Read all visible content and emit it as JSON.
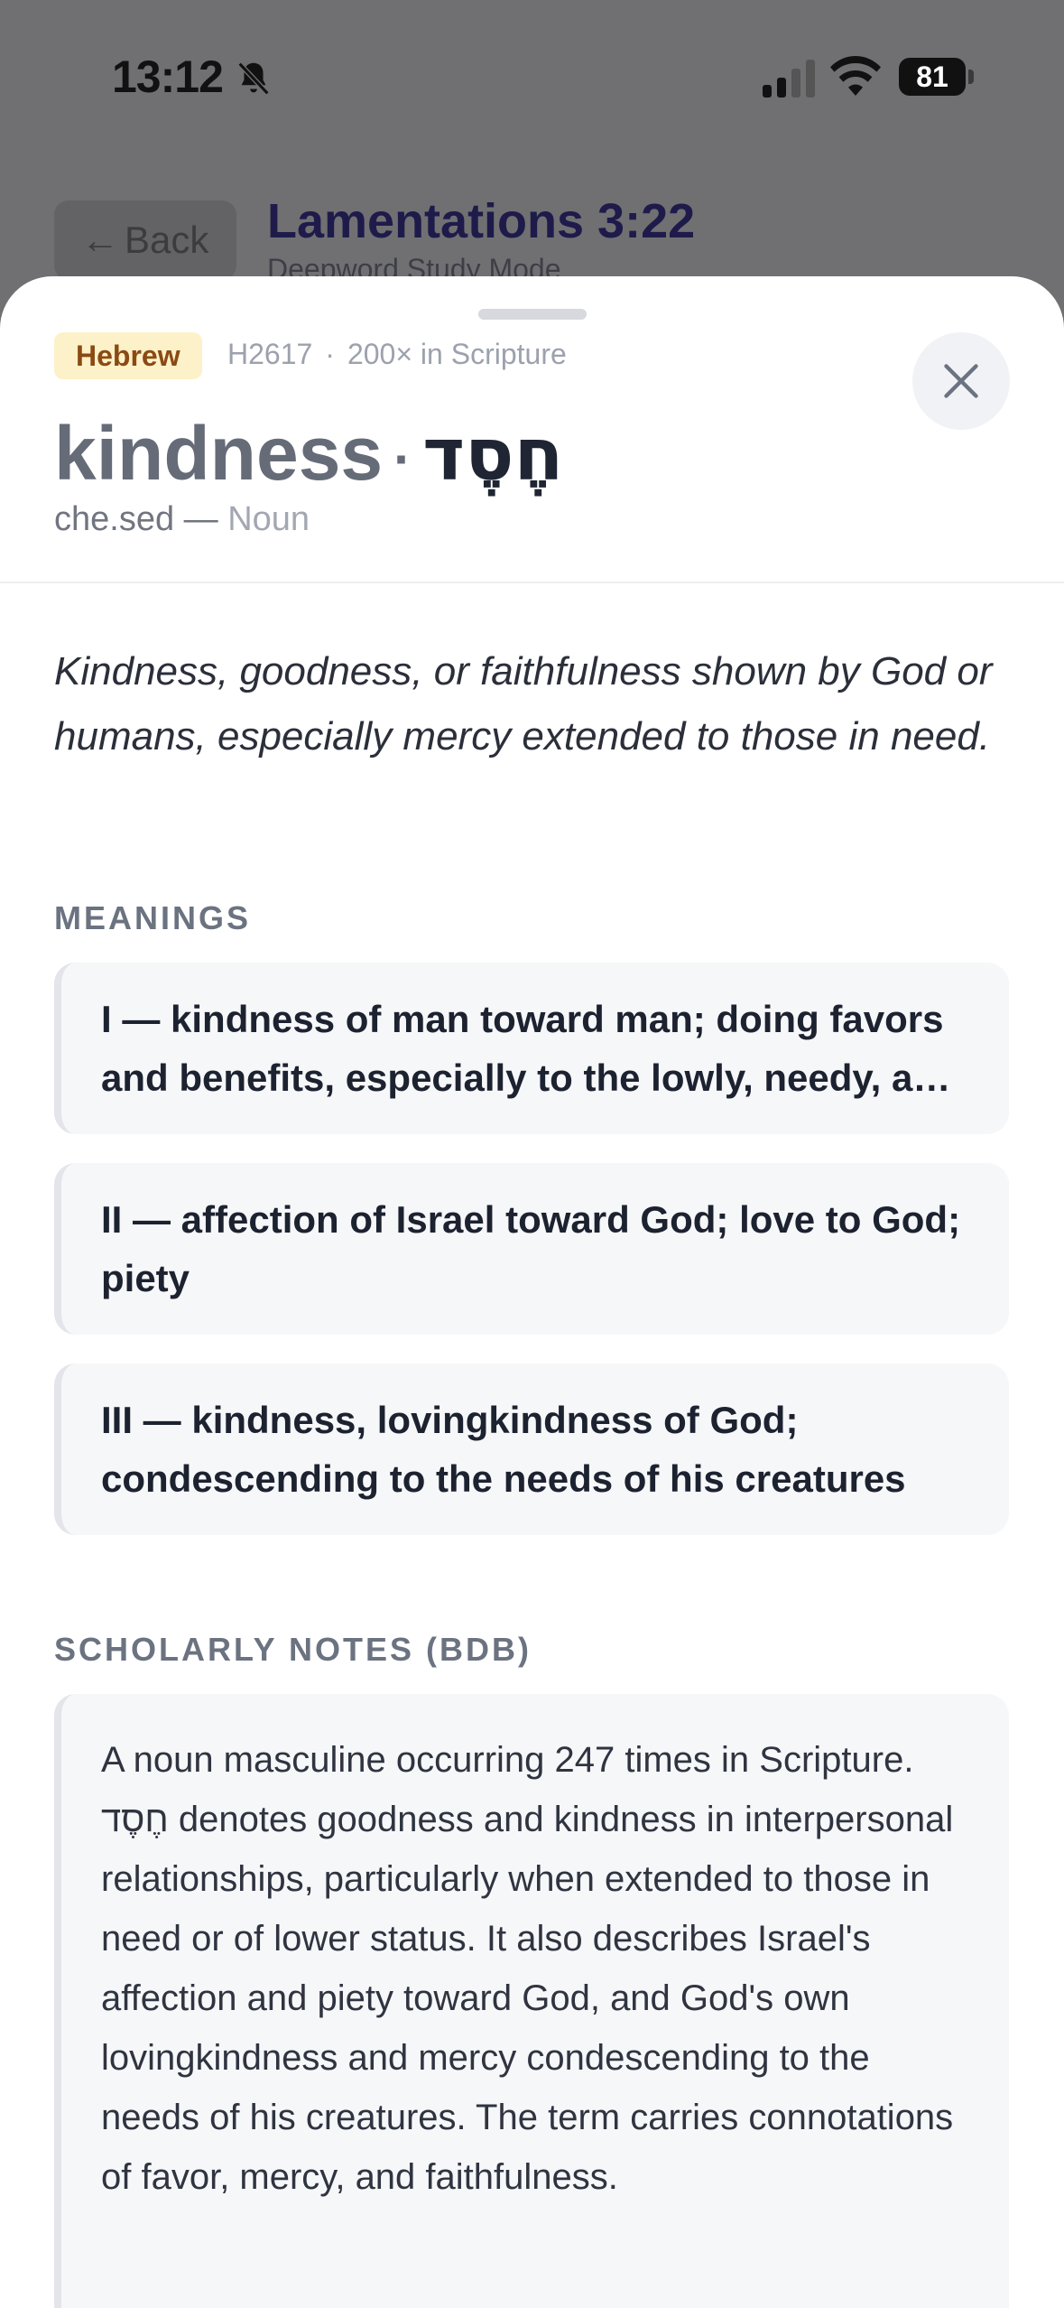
{
  "status_bar": {
    "time": "13:12",
    "battery": "81"
  },
  "background": {
    "back_label": "Back",
    "title": "Lamentations 3:22",
    "subtitle": "Deepword Study Mode"
  },
  "sheet": {
    "language_badge": "Hebrew",
    "strongs": "H2617",
    "separator": "·",
    "occurrences": "200× in Scripture",
    "english_word": "kindness",
    "title_separator": "·",
    "hebrew_word": "חֶסֶד",
    "transliteration": "che.sed —",
    "part_of_speech": "Noun",
    "definition": "Kindness, goodness, or faithfulness shown by God or humans, especially mercy extended to those in need.",
    "meanings_heading": "MEANINGS",
    "meanings": [
      "I — kindness of man toward man; doing favors and benefits, especially to the lowly, needy, and miserable",
      "II — affection of Israel toward God; love to God; piety",
      "III — kindness, lovingkindness of God; condescending to the needs of his creatures"
    ],
    "notes_heading": "SCHOLARLY NOTES (BDB)",
    "notes": "A noun masculine occurring 247 times in Scripture. חֶסֶד denotes goodness and kindness in interpersonal relationships, particularly when extended to those in need or of lower status. It also describes Israel's affection and piety toward God, and God's own lovingkindness and mercy condescending to the needs of his creatures. The term carries connotations of favor, mercy, and faithfulness."
  },
  "icons": {
    "bell": "bell-slash-icon",
    "signal": "cellular-signal-icon",
    "wifi": "wifi-icon",
    "back": "arrow-left-icon",
    "close": "close-icon"
  },
  "colors": {
    "badge_bg": "#fdf1c9",
    "badge_text": "#8a4a13",
    "title_dark": "#1e1b4b",
    "card_bg": "#f6f7f9"
  }
}
